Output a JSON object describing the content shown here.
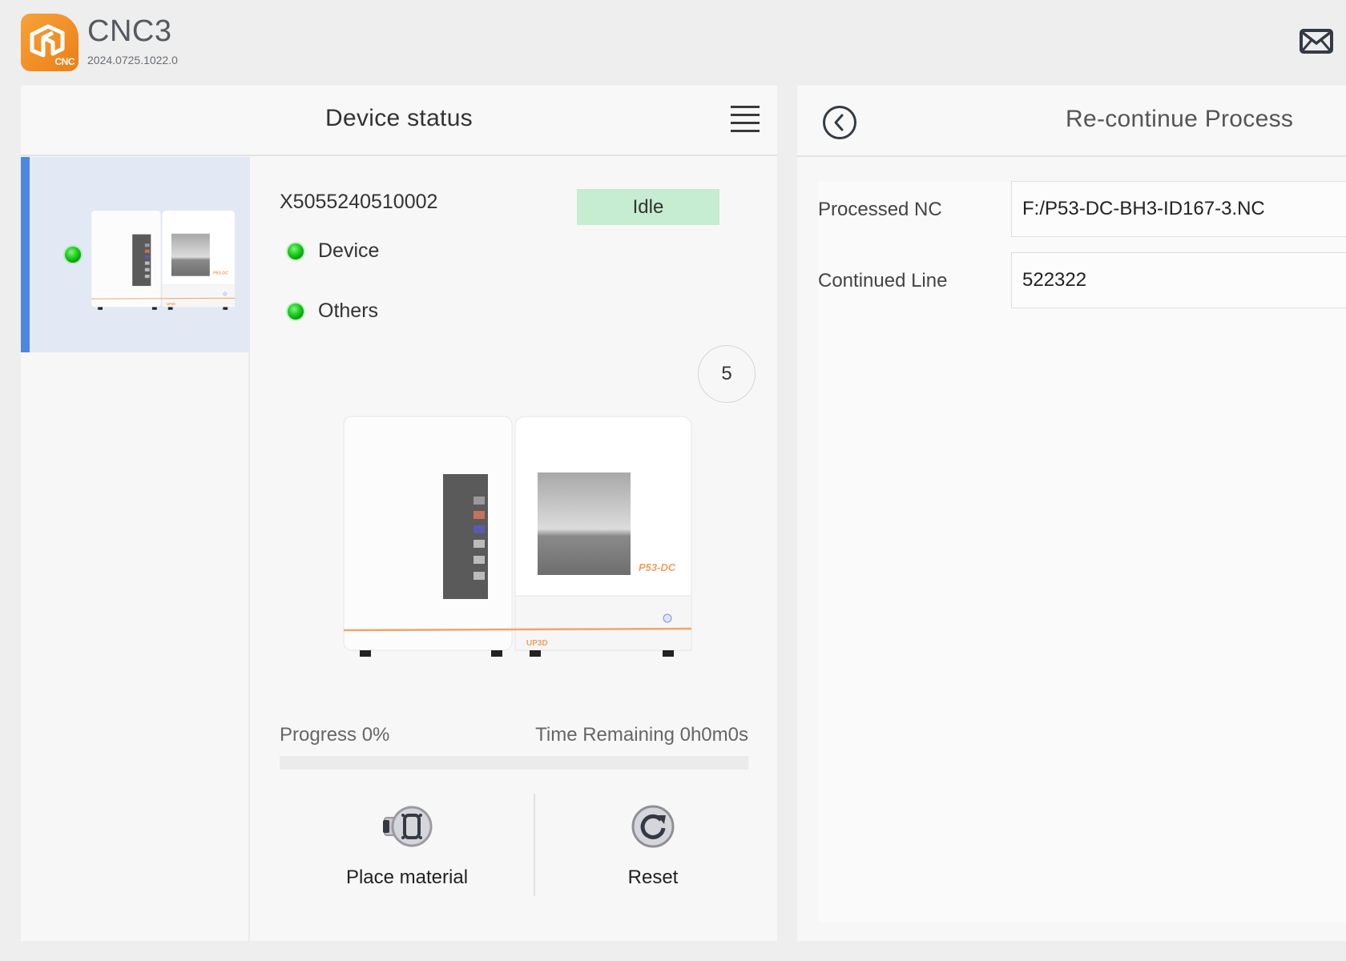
{
  "app": {
    "title": "CNC3",
    "version": "2024.0725.1022.0",
    "logo_badge": "CNC",
    "brand_color": "#f39324"
  },
  "header": {
    "mail_icon": "envelope-icon"
  },
  "device_panel": {
    "title": "Device status",
    "menu_icon": "hamburger-menu-icon",
    "devices": [
      {
        "status_color": "#22cc22",
        "selected": true
      }
    ],
    "detail": {
      "serial": "X5055240510002",
      "status": "Idle",
      "status_color": "#c6ecd1",
      "indicators": [
        {
          "label": "Device",
          "state": "ok",
          "color": "#22cc22"
        },
        {
          "label": "Others",
          "state": "ok",
          "color": "#22cc22"
        }
      ],
      "count": "5",
      "machine_model": "P53-DC",
      "machine_brand": "UP3D",
      "progress_label": "Progress 0%",
      "progress_value": 0,
      "time_remaining_label": "Time Remaining 0h0m0s",
      "actions": [
        {
          "label": "Place material",
          "icon": "place-material-icon"
        },
        {
          "label": "Reset",
          "icon": "reset-icon"
        }
      ]
    }
  },
  "recontinue_panel": {
    "title": "Re-continue Process",
    "back_icon": "back-arrow-icon",
    "fields": [
      {
        "label": "Processed NC",
        "value": "F:/P53-DC-BH3-ID167-3.NC"
      },
      {
        "label": "Continued Line",
        "value": "522322"
      }
    ]
  }
}
